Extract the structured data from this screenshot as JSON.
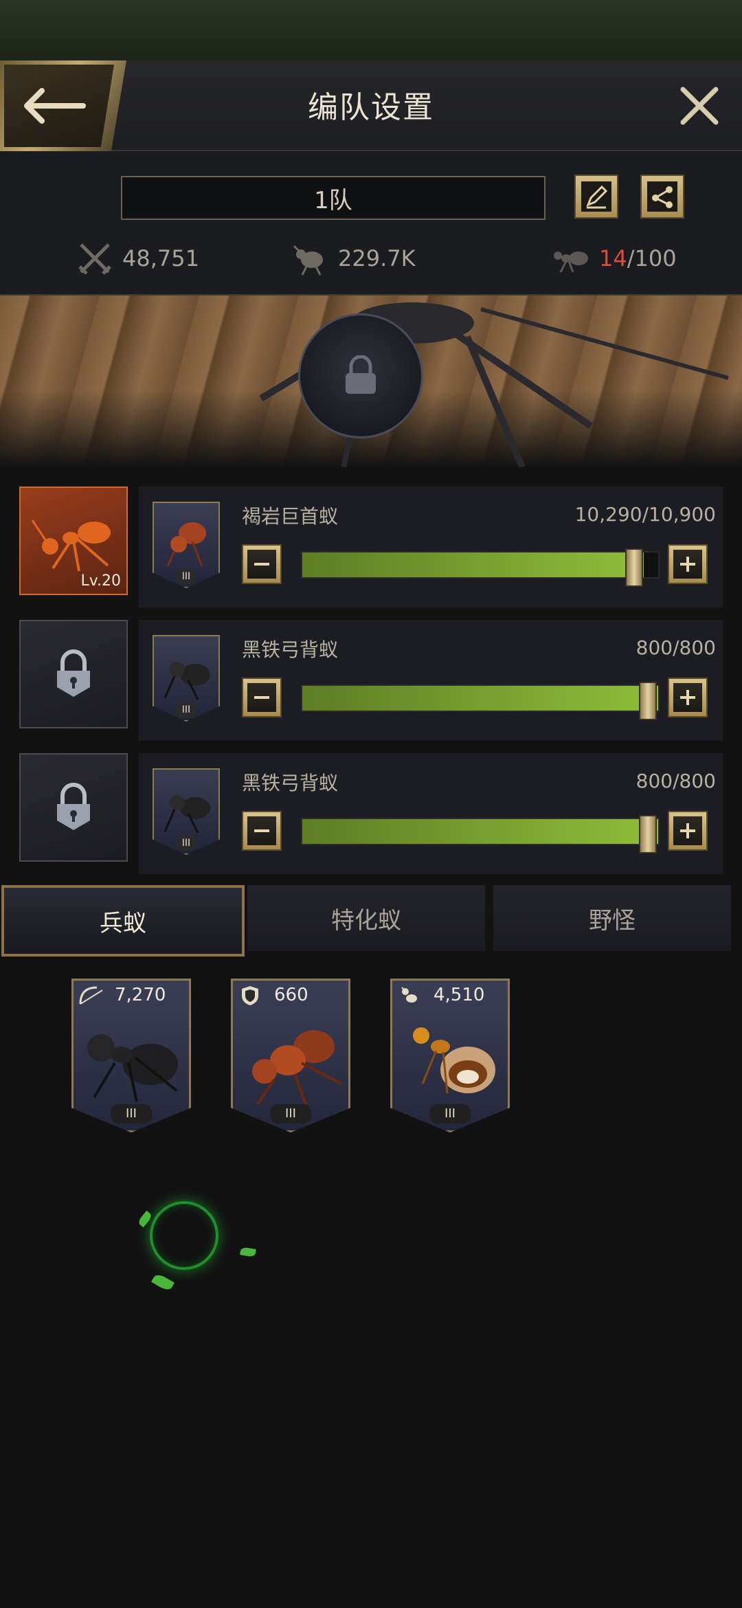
{
  "header": {
    "title": "编队设置"
  },
  "team": {
    "name": "1队",
    "stats": {
      "attack": "48,751",
      "load": "229.7K",
      "capacity_used": "14",
      "capacity_total": "/100"
    }
  },
  "hero_slot": {
    "level": "Lv.20"
  },
  "rows": [
    {
      "unit_name": "褐岩巨首蚁",
      "count": "10,290/10,900",
      "tier": "III",
      "fill_percent": 96
    },
    {
      "unit_name": "黑铁弓背蚁",
      "count": "800/800",
      "tier": "III",
      "fill_percent": 100
    },
    {
      "unit_name": "黑铁弓背蚁",
      "count": "800/800",
      "tier": "III",
      "fill_percent": 100
    }
  ],
  "tabs": [
    {
      "label": "兵蚁",
      "active": true
    },
    {
      "label": "特化蚁",
      "active": false
    },
    {
      "label": "野怪",
      "active": false
    }
  ],
  "unit_cards": [
    {
      "count": "7,270",
      "tier": "III",
      "type_icon": "bow-icon"
    },
    {
      "count": "660",
      "tier": "III",
      "type_icon": "shield-icon"
    },
    {
      "count": "4,510",
      "tier": "III",
      "type_icon": "ant-icon"
    }
  ],
  "colors": {
    "gold": "#c2ab73",
    "slider_green": "#8fbe3a",
    "capacity_red": "#e04b3d"
  }
}
